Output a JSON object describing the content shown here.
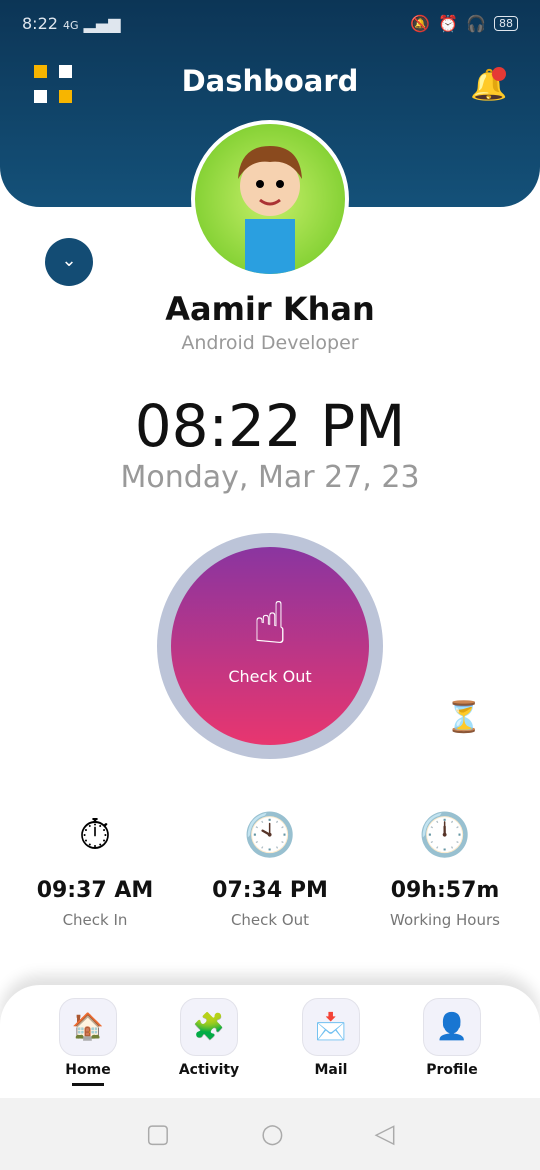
{
  "status": {
    "time": "8:22",
    "network": "4G",
    "battery": "88"
  },
  "header": {
    "title": "Dashboard"
  },
  "profile": {
    "name": "Aamir Khan",
    "role": "Android Developer"
  },
  "clock": {
    "time": "08:22 PM",
    "date": "Monday, Mar 27, 23"
  },
  "action": {
    "label": "Check Out"
  },
  "stats": [
    {
      "value": "09:37 AM",
      "label": "Check In"
    },
    {
      "value": "07:34 PM",
      "label": "Check Out"
    },
    {
      "value": "09h:57m",
      "label": "Working Hours"
    }
  ],
  "nav": [
    {
      "label": "Home",
      "active": true
    },
    {
      "label": "Activity"
    },
    {
      "label": "Mail"
    },
    {
      "label": "Profile"
    }
  ],
  "colors": {
    "header": "#0c3556",
    "accent": "#f7b500",
    "button_top": "#8a35a0",
    "button_bottom": "#e8366f"
  }
}
